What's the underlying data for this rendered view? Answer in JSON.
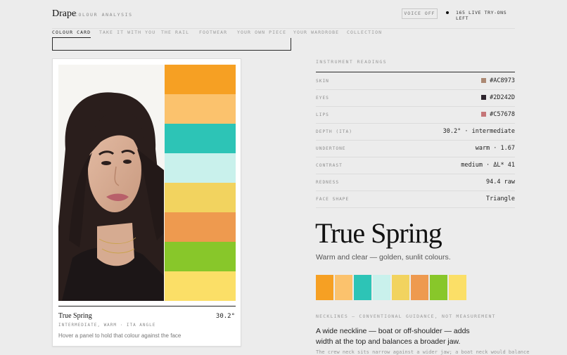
{
  "header": {
    "logo": "Drape",
    "subtitle": "COLOUR ANALYSIS",
    "voice_button": "VOICE OFF",
    "live_status": "165 LIVE TRY-ONS LEFT"
  },
  "tabs": [
    {
      "label": "COLOUR CARD",
      "active": true
    },
    {
      "label": "TAKE IT WITH YOU",
      "active": false
    },
    {
      "label": "THE RAIL",
      "active": false
    },
    {
      "label": "FOOTWEAR",
      "active": false
    },
    {
      "label": "YOUR OWN PIECE",
      "active": false
    },
    {
      "label": "YOUR WARDROBE",
      "active": false
    },
    {
      "label": "COLLECTION",
      "active": false
    }
  ],
  "card": {
    "palette": [
      "#F6A023",
      "#FBC26D",
      "#2DC4B6",
      "#C9F1EC",
      "#F2D35F",
      "#EE9A4F",
      "#88C72A",
      "#FBDF67"
    ],
    "season_name": "True Spring",
    "angle": "30.2°",
    "meta": "INTERMEDIATE, WARM · ITA ANGLE",
    "hint": "Hover a panel to hold that colour against the face"
  },
  "readings": {
    "title": "INSTRUMENT READINGS",
    "rows": [
      {
        "label": "SKIN",
        "value": "#AC8973",
        "color": "#AC8973"
      },
      {
        "label": "EYES",
        "value": "#2D242D",
        "color": "#2D242D"
      },
      {
        "label": "LIPS",
        "value": "#C57678",
        "color": "#C57678"
      },
      {
        "label": "DEPTH (ITA)",
        "value": "30.2° · intermediate"
      },
      {
        "label": "UNDERTONE",
        "value": "warm · 1.67"
      },
      {
        "label": "CONTRAST",
        "value": "medium · ΔL* 41"
      },
      {
        "label": "REDNESS",
        "value": "94.4 raw"
      },
      {
        "label": "FACE SHAPE",
        "value": "Triangle"
      }
    ]
  },
  "season": {
    "name": "True Spring",
    "description": "Warm and clear — golden, sunlit colours.",
    "strip": [
      "#F6A023",
      "#FBC26D",
      "#2DC4B6",
      "#C9F1EC",
      "#F2D35F",
      "#EE9A4F",
      "#88C72A",
      "#FBDF67"
    ]
  },
  "necklines": {
    "title": "NECKLINES — CONVENTIONAL GUIDANCE, NOT MEASUREMENT",
    "text": "A wide neckline — boat or off-shoulder — adds width at the top and balances a broader jaw.",
    "sub": "The crew neck sits narrow against a wider jaw; a boat neck would balance"
  }
}
